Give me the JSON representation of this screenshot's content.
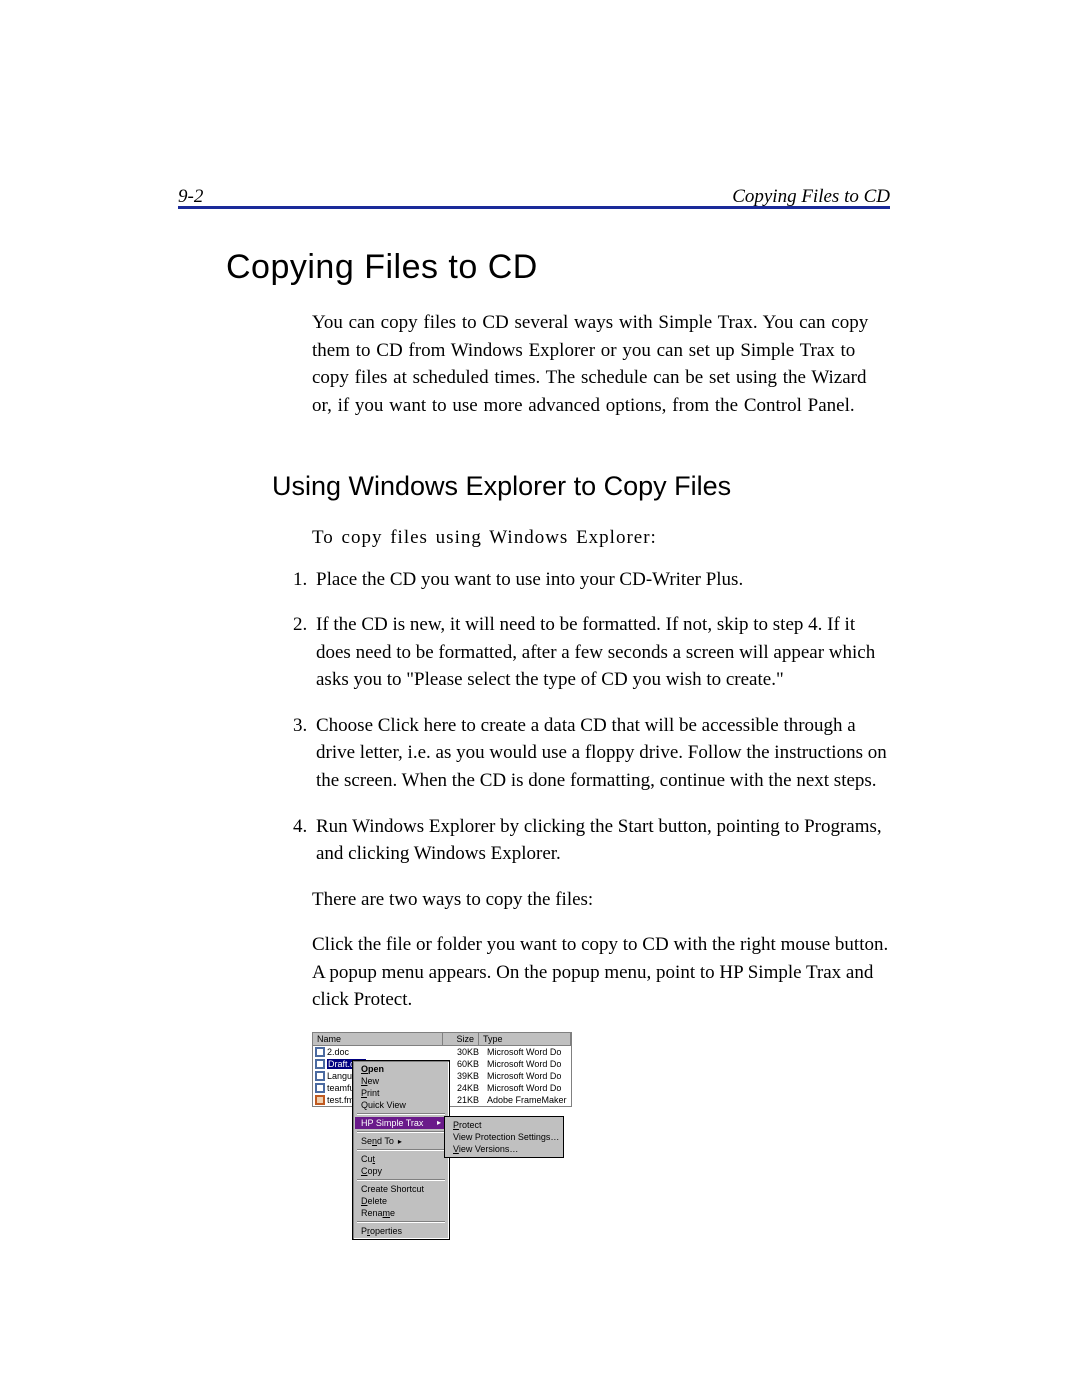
{
  "page": {
    "number": "9-2",
    "running_title": "Copying Files to CD"
  },
  "h1": "Copying Files to CD",
  "intro": "You can copy files to CD several ways with Simple Trax. You can copy them to CD from Windows Explorer or you can set up Simple Trax to copy files at scheduled times. The schedule can be set using the Wizard or, if you want to use more advanced options, from the Control Panel.",
  "h2": "Using Windows Explorer to Copy Files",
  "lead": "To copy files using Windows Explorer:",
  "steps": [
    "Place the CD you want to use into your CD-Writer Plus.",
    "If the CD is new, it will need to be formatted. If not, skip to step 4. If it does need to be formatted, after a few seconds a screen will appear which asks you to \"Please select the type of CD you wish to create.\"",
    "Choose Click here to create a data CD that will be accessible through a drive letter, i.e. as you would use a floppy drive. Follow the instructions on the screen. When the CD is done formatting, continue with the next steps.",
    "Run Windows Explorer by clicking the Start button, pointing to Programs, and clicking Windows Explorer."
  ],
  "after1": "There are two ways to copy the files:",
  "after2": "Click the file or folder you want to copy to CD with the right mouse button. A popup menu appears. On the popup menu, point to HP Simple Trax and click Protect.",
  "filelist": {
    "headers": {
      "name": "Name",
      "size": "Size",
      "type": "Type"
    },
    "rows": [
      {
        "name": "2.doc",
        "size": "30KB",
        "type": "Microsoft Word Do"
      },
      {
        "name": "Draft.doc",
        "size": "60KB",
        "type": "Microsoft Word Do",
        "selected": true
      },
      {
        "name": "Langu",
        "size": "39KB",
        "type": "Microsoft Word Do"
      },
      {
        "name": "teamfu",
        "size": "24KB",
        "type": "Microsoft Word Do"
      },
      {
        "name": "test.fm",
        "size": "21KB",
        "type": "Adobe FrameMaker"
      }
    ]
  },
  "context_menu": {
    "open": "Open",
    "new": "New",
    "print": "Print",
    "quick_view": "Quick View",
    "hp_simple_trax": "HP Simple Trax",
    "send_to": "Send To",
    "cut": "Cut",
    "copy": "Copy",
    "create_shortcut": "Create Shortcut",
    "delete": "Delete",
    "rename": "Rename",
    "properties": "Properties"
  },
  "submenu": {
    "protect": "Protect",
    "view_protection_settings": "View Protection Settings…",
    "view_versions": "View Versions…"
  }
}
